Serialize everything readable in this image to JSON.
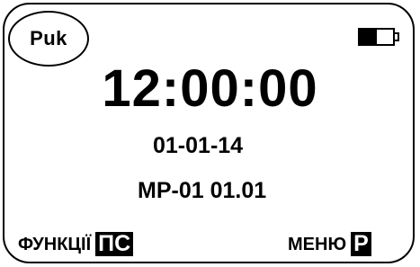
{
  "screen": {
    "mode_label": "Puk",
    "battery_icon": "battery-low-icon",
    "time": "12:00:00",
    "date": "01-01-14",
    "model": "MP-01 01.01"
  },
  "softkeys": {
    "left_label": "ФУНКЦІЇ",
    "left_key": "ПС",
    "right_label": "МЕНЮ",
    "right_key": "Р"
  }
}
